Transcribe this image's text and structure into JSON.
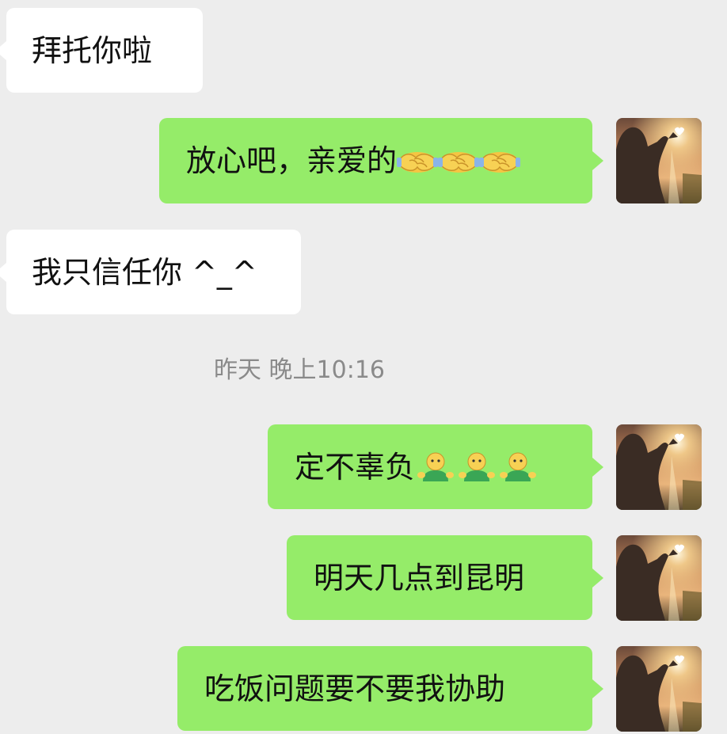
{
  "conversation": {
    "messages": [
      {
        "from": "contact",
        "text": "拜托你啦"
      },
      {
        "from": "me",
        "text": "放心吧，亲爱的",
        "emoji": "handshake-emoji",
        "emoji_count": 3
      },
      {
        "from": "contact",
        "text": "我只信任你 ^_^"
      },
      {
        "from": "me",
        "text": "定不辜负",
        "emoji": "hug-emoji",
        "emoji_count": 3
      },
      {
        "from": "me",
        "text": "明天几点到昆明"
      },
      {
        "from": "me",
        "text": "吃饭问题要不要我协助"
      }
    ],
    "timestamp": "昨天 晚上10:16",
    "avatar_icon": "user-avatar-photo",
    "colors": {
      "background": "#ededed",
      "incoming_bubble": "#ffffff",
      "outgoing_bubble": "#95ec69",
      "timestamp_text": "#8a8a8a"
    }
  }
}
